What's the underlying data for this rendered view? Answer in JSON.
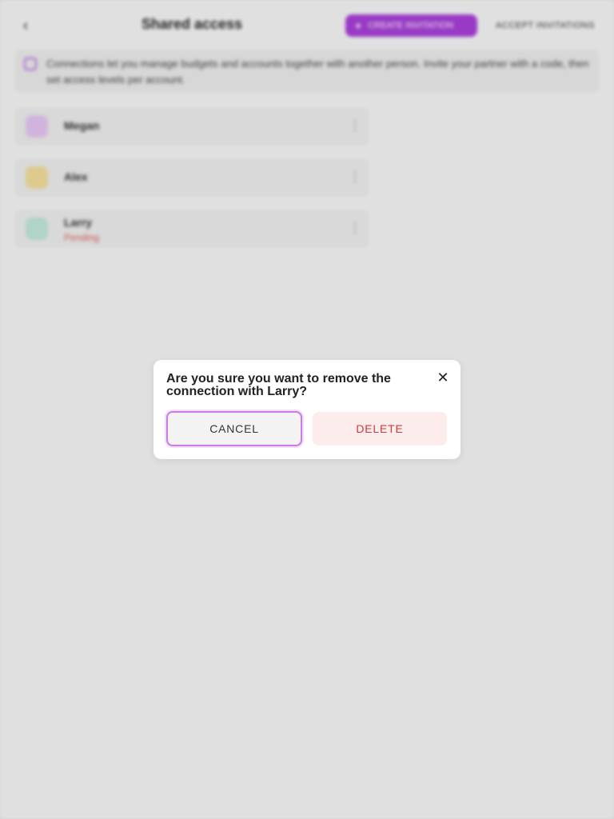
{
  "header": {
    "title": "Shared access",
    "back_icon": "chevron-left-icon",
    "create_label": "CREATE INVITATION",
    "accept_label": "ACCEPT INVITATIONS",
    "accent_color": "#a63fd6"
  },
  "banner": {
    "text": "Connections let you manage budgets and accounts together with another person. Invite your partner with a code, then set access levels per account."
  },
  "connections": [
    {
      "name": "Megan",
      "status": "",
      "avatar_color": "#e3c4f0"
    },
    {
      "name": "Alex",
      "status": "",
      "avatar_color": "#f0dc9a"
    },
    {
      "name": "Larry",
      "status": "Pending",
      "avatar_color": "#bfe6d8"
    }
  ],
  "dialog": {
    "message": "Are you sure you want to remove the connection with Larry?",
    "cancel_label": "CANCEL",
    "delete_label": "DELETE",
    "close_icon": "close-icon"
  }
}
